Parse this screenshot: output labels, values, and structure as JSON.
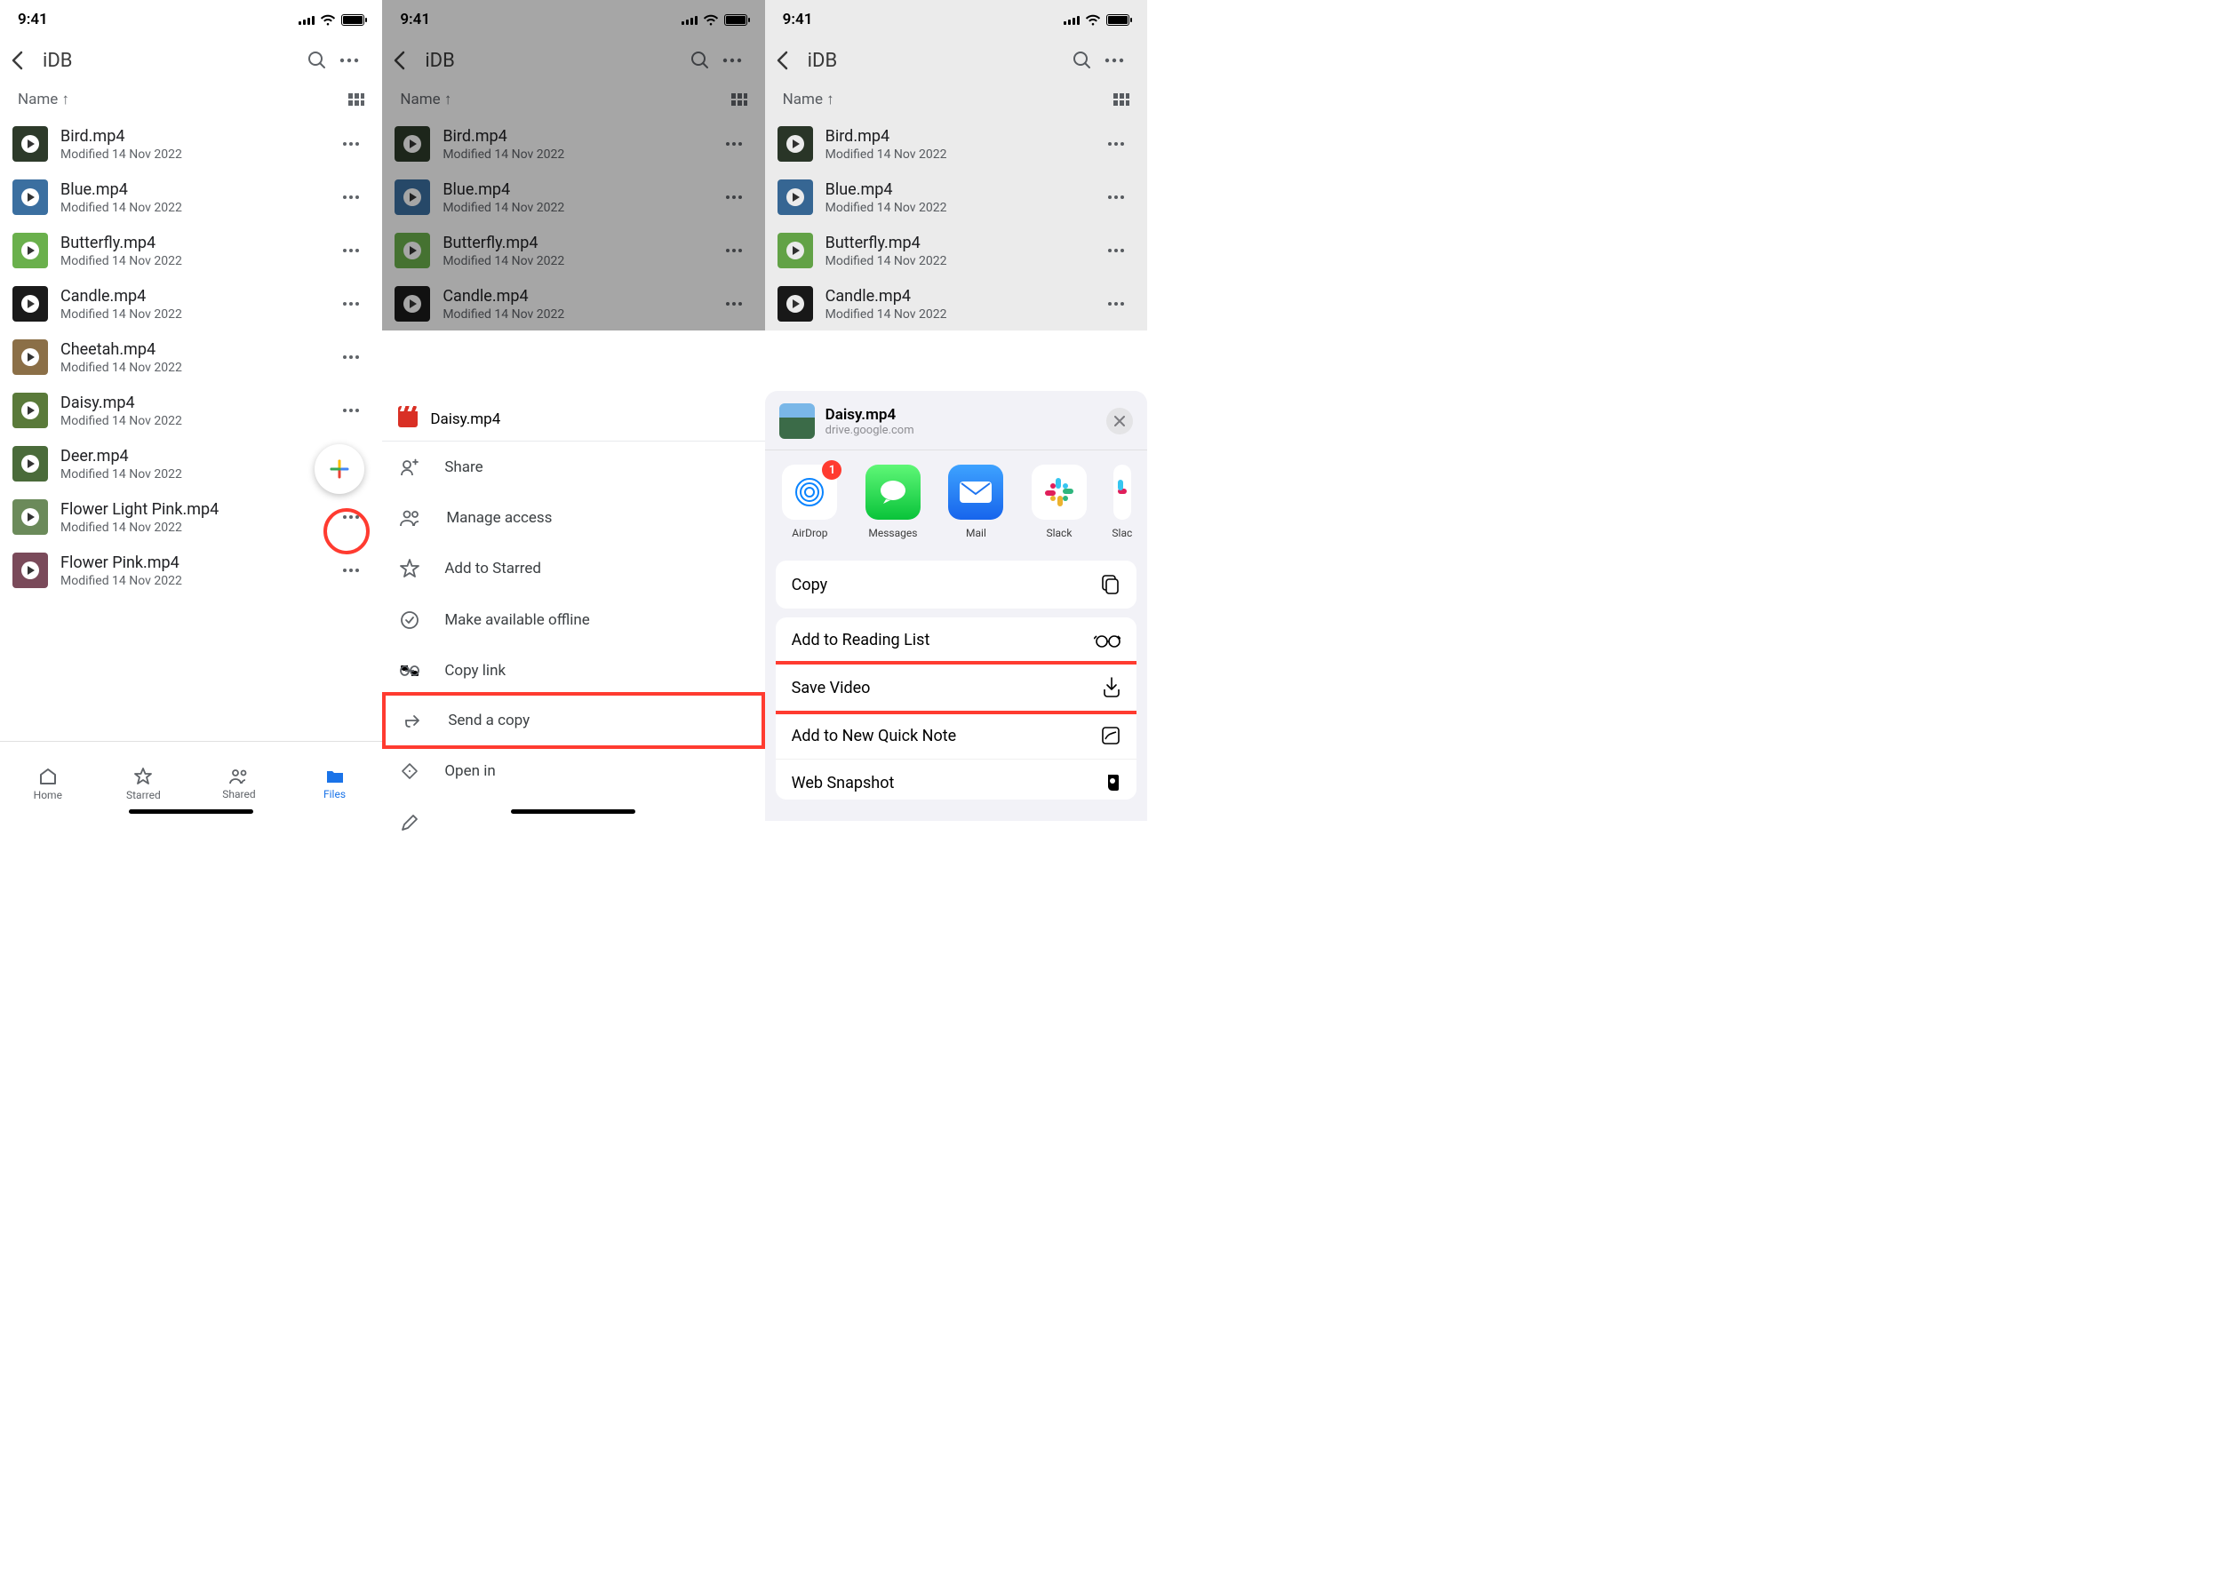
{
  "status": {
    "time": "9:41"
  },
  "header": {
    "folder": "iDB"
  },
  "sort": {
    "label": "Name ↑"
  },
  "files": [
    {
      "name": "Bird.mp4",
      "meta": "Modified 14 Nov 2022",
      "bg": "#2d3a2a"
    },
    {
      "name": "Blue.mp4",
      "meta": "Modified 14 Nov 2022",
      "bg": "#3b6fa0"
    },
    {
      "name": "Butterfly.mp4",
      "meta": "Modified 14 Nov 2022",
      "bg": "#6ab04c"
    },
    {
      "name": "Candle.mp4",
      "meta": "Modified 14 Nov 2022",
      "bg": "#1a1a1a"
    },
    {
      "name": "Cheetah.mp4",
      "meta": "Modified 14 Nov 2022",
      "bg": "#8b6f47"
    },
    {
      "name": "Daisy.mp4",
      "meta": "Modified 14 Nov 2022",
      "bg": "#5a7a3a"
    },
    {
      "name": "Deer.mp4",
      "meta": "Modified 14 Nov 2022",
      "bg": "#4a6b3a"
    },
    {
      "name": "Flower Light Pink.mp4",
      "meta": "Modified 14 Nov 2022",
      "bg": "#6b8a5a"
    },
    {
      "name": "Flower Pink.mp4",
      "meta": "Modified 14 Nov 2022",
      "bg": "#7a4a5a"
    }
  ],
  "tabs": {
    "home": "Home",
    "starred": "Starred",
    "shared": "Shared",
    "files": "Files"
  },
  "sheet": {
    "title": "Daisy.mp4",
    "items": {
      "share": "Share",
      "manage": "Manage access",
      "star": "Add to Starred",
      "offline": "Make available offline",
      "link": "Copy link",
      "send": "Send a copy",
      "open": "Open in"
    }
  },
  "iosShare": {
    "title": "Daisy.mp4",
    "source": "drive.google.com",
    "apps": {
      "airdrop": {
        "label": "AirDrop",
        "badge": "1"
      },
      "messages": {
        "label": "Messages"
      },
      "mail": {
        "label": "Mail"
      },
      "slack": {
        "label": "Slack"
      },
      "slack2": {
        "label": "Slac"
      }
    },
    "actions": {
      "copy": "Copy",
      "reading": "Add to Reading List",
      "save": "Save Video",
      "quicknote": "Add to New Quick Note",
      "snapshot": "Web Snapshot"
    }
  }
}
